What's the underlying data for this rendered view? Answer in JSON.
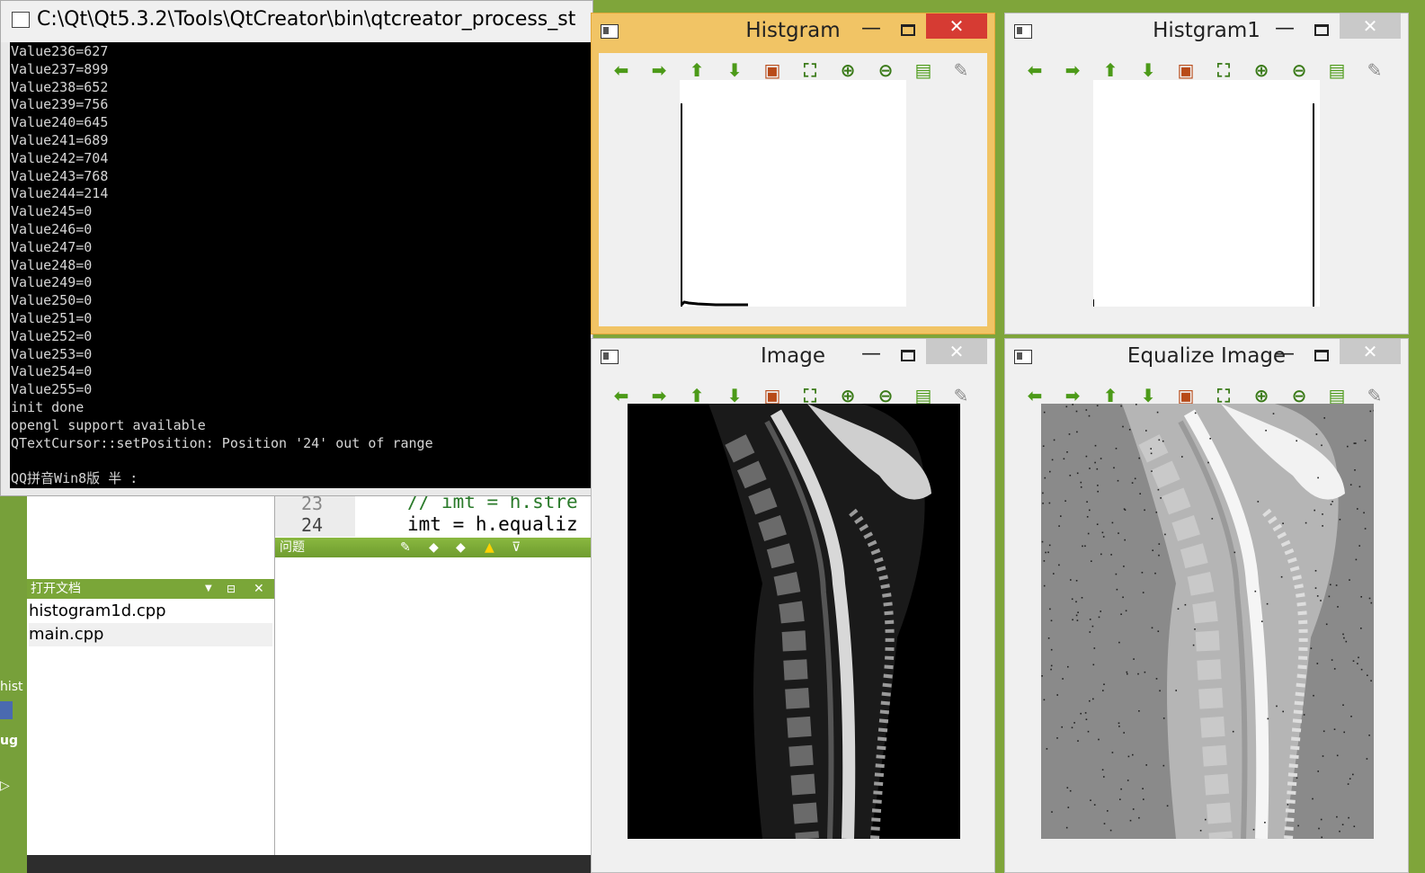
{
  "console": {
    "title": "C:\\Qt\\Qt5.3.2\\Tools\\QtCreator\\bin\\qtcreator_process_st",
    "lines": [
      "Value236=627",
      "Value237=899",
      "Value238=652",
      "Value239=756",
      "Value240=645",
      "Value241=689",
      "Value242=704",
      "Value243=768",
      "Value244=214",
      "Value245=0",
      "Value246=0",
      "Value247=0",
      "Value248=0",
      "Value249=0",
      "Value250=0",
      "Value251=0",
      "Value252=0",
      "Value253=0",
      "Value254=0",
      "Value255=0",
      "init done",
      "opengl support available",
      "QTextCursor::setPosition: Position '24' out of range",
      "",
      "QQ拼音Win8版 半 :"
    ]
  },
  "qtcreator": {
    "left_labels": [
      "hist",
      "ug"
    ],
    "open_docs_header": "打开文档",
    "open_docs": [
      "histogram1d.cpp",
      "main.cpp"
    ],
    "code_lines": [
      {
        "num": "23",
        "text": "// imt = h.stre"
      },
      {
        "num": "24",
        "text": "imt = h.equaliz"
      }
    ],
    "problems_header": "问题"
  },
  "windows": {
    "histgram": {
      "title": "Histgram",
      "close": "✕",
      "min": "—"
    },
    "histgram1": {
      "title": "Histgram1",
      "close": "✕",
      "min": "—"
    },
    "image": {
      "title": "Image",
      "close": "✕",
      "min": "—"
    },
    "equalize": {
      "title": "Equalize Image",
      "close": "✕",
      "min": "—"
    }
  },
  "toolbar_icons": [
    "arrow-left-icon",
    "arrow-right-icon",
    "arrow-up-icon",
    "arrow-down-icon",
    "image-icon",
    "zoom-fit-icon",
    "zoom-in-icon",
    "zoom-out-icon",
    "save-icon",
    "brush-icon"
  ],
  "colors": {
    "accent_green": "#7fa53a",
    "active_title": "#f1c465",
    "close_red": "#d63b33",
    "console_bg": "#000000"
  }
}
